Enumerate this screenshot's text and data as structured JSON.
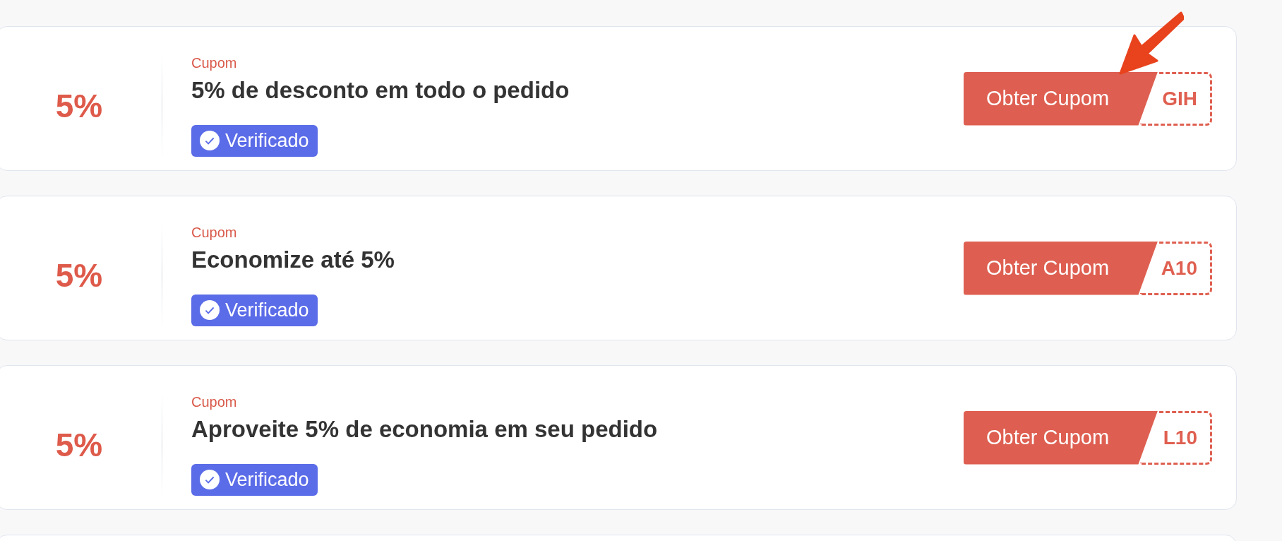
{
  "coupons": [
    {
      "discount": "5%",
      "type_label": "Cupom",
      "title": "5% de desconto em todo o pedido",
      "badge": "Verificado",
      "button": "Obter Cupom",
      "code_visible": "GIH",
      "annotation_arrow": true
    },
    {
      "discount": "5%",
      "type_label": "Cupom",
      "title": "Economize até 5%",
      "badge": "Verificado",
      "button": "Obter Cupom",
      "code_visible": "A10",
      "annotation_arrow": false
    },
    {
      "discount": "5%",
      "type_label": "Cupom",
      "title": "Aproveite 5% de economia em seu pedido",
      "badge": "Verificado",
      "button": "Obter Cupom",
      "code_visible": "L10",
      "annotation_arrow": false
    }
  ]
}
